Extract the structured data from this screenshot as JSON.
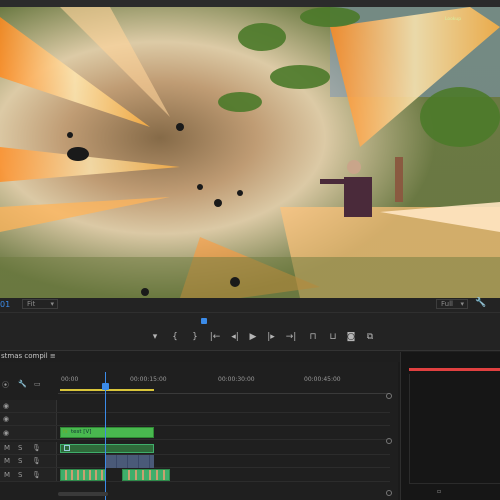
{
  "viewer": {
    "watermark": "Lookup",
    "timecode": "01",
    "fit_label": "Fit",
    "quality_label": "Full"
  },
  "transport": {
    "buttons": [
      "mark-in",
      "mark-out",
      "clip-in",
      "go-in",
      "step-back",
      "play",
      "step-fwd",
      "go-out",
      "insert",
      "overwrite",
      "export-frame",
      "comparison"
    ]
  },
  "sequence": {
    "tab_label": "stmas compil",
    "tab_menu": "≡"
  },
  "timeline": {
    "ruler_labels": [
      "00:00",
      "00:00:15:00",
      "00:00:30:00",
      "00:00:45:00"
    ],
    "tracks": [
      {
        "type": "video",
        "id": "V3"
      },
      {
        "type": "video",
        "id": "V2"
      },
      {
        "type": "video",
        "id": "V1"
      },
      {
        "type": "audio",
        "id": "A1",
        "m": "M",
        "s": "S"
      },
      {
        "type": "audio",
        "id": "A2",
        "m": "M",
        "s": "S"
      },
      {
        "type": "audio",
        "id": "A3",
        "m": "M",
        "s": "S"
      }
    ],
    "video_clip_label": "fx",
    "video_clip_name": "test [V]"
  },
  "colors": {
    "accent": "#3b8be8",
    "clip_video": "#49b84f",
    "clip_audio": "#3fae6b",
    "in_out": "#d9c53a",
    "audio_meter": "#e04040"
  }
}
